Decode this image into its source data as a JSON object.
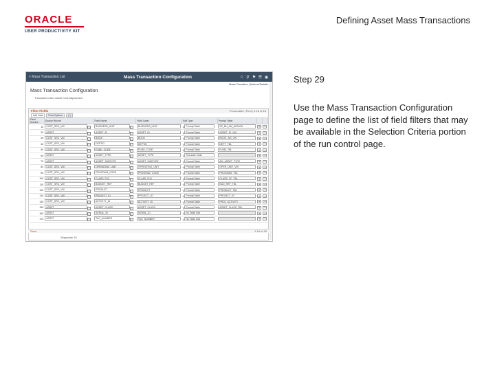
{
  "logo": {
    "brand": "ORACLE",
    "product": "USER PRODUCTIVITY KIT"
  },
  "slide_title": "Defining Asset Mass Transactions",
  "step": {
    "title": "Step 29",
    "description": "Use the Mass Transaction Configuration page to define the list of field filters that may be available in the Selection Criteria portion of the run control page."
  },
  "screenshot": {
    "banner": {
      "back": "< Mass Transaction List",
      "title": "Mass Transaction Configuration"
    },
    "sublinks": "Mass Transfers | Actions/Details",
    "page_title": "Mass Transaction Configuration",
    "transaction": {
      "label": "Transaction",
      "code": "ADJ",
      "desc": "Asset Cost Adjustment"
    },
    "grid": {
      "title": "Filter Fields",
      "nav": "Personalize | Find | 1-18 of 18",
      "tabs": [
        "Add Lists",
        "Field Options",
        "(+)"
      ],
      "columns": [
        "Field Number",
        "Source Record",
        "Field Name",
        "Field Label",
        "Edit Type",
        "Prompt Table",
        "",
        ""
      ],
      "rows": [
        {
          "num": "10",
          "rec": "COST_SRC_VW",
          "field": "BUSINESS_UNIT",
          "label": "BUSINESS_UNIT",
          "edit": "Prompt Table",
          "prompt": "SP_BU_AM_NONVW"
        },
        {
          "num": "20",
          "rec": "ASSET",
          "field": "ASSET_ID",
          "label": "ASSET_ID",
          "edit": "Prompt Table",
          "prompt": "ASSET_ID_VW"
        },
        {
          "num": "30",
          "rec": "COST_SRC_VW",
          "field": "BOOK",
          "label": "BOOK",
          "edit": "Prompt Table",
          "prompt": "BOOK_AM_VW"
        },
        {
          "num": "40",
          "rec": "COST_SRC_VW",
          "field": "DEPTID",
          "label": "DEPTID",
          "edit": "Prompt Table",
          "prompt": "DEPT_TBL"
        },
        {
          "num": "50",
          "rec": "COST_SRC_VW",
          "field": "FUND_CODE",
          "label": "FUND_CODE",
          "edit": "Prompt Table",
          "prompt": "FUND_TBL"
        },
        {
          "num": "60",
          "rec": "ASSET",
          "field": "ASSET_TYPE",
          "label": "ASSET_TYPE",
          "edit": "Translate Table",
          "prompt": ""
        },
        {
          "num": "70",
          "rec": "ASSET",
          "field": "ASSET_SUBTYPE",
          "label": "ASSET_SUBTYPE",
          "edit": "Prompt Table",
          "prompt": "AM_ASSET_TYPE"
        },
        {
          "num": "80",
          "rec": "COST_SRC_VW",
          "field": "OPERATING_UNIT",
          "label": "OPERATING_UNIT",
          "edit": "Prompt Table",
          "prompt": "OPER_UNIT_VW"
        },
        {
          "num": "90",
          "rec": "COST_SRC_VW",
          "field": "PROGRAM_CODE",
          "label": "PROGRAM_CODE",
          "edit": "Prompt Table",
          "prompt": "PROGRAM_TBL"
        },
        {
          "num": "100",
          "rec": "COST_SRC_VW",
          "field": "CLASS_FLD",
          "label": "CLASS_FLD",
          "edit": "Prompt Table",
          "prompt": "CLASS_CF_TBL"
        },
        {
          "num": "110",
          "rec": "COST_SRC_VW",
          "field": "BUDGET_REF",
          "label": "BUDGET_REF",
          "edit": "Prompt Table",
          "prompt": "BUD_REF_TBL"
        },
        {
          "num": "120",
          "rec": "COST_SRC_VW",
          "field": "PRODUCT",
          "label": "PRODUCT",
          "edit": "Prompt Table",
          "prompt": "PRODUCT_TBL"
        },
        {
          "num": "130",
          "rec": "COST_SRC_VW",
          "field": "PROJECT_ID",
          "label": "PROJECT_ID",
          "edit": "Prompt Table",
          "prompt": "PROJECT_ID"
        },
        {
          "num": "140",
          "rec": "COST_SRC_VW",
          "field": "ACTIVITY_ID",
          "label": "ACTIVITY_ID",
          "edit": "Prompt Table",
          "prompt": "PROJ_ACTIVITY"
        },
        {
          "num": "150",
          "rec": "ASSET",
          "field": "ASSET_CLASS",
          "label": "ASSET_CLASS",
          "edit": "Prompt Table",
          "prompt": "ASSET_CLASS_TBL"
        },
        {
          "num": "160",
          "rec": "ASSET",
          "field": "SERIAL_ID",
          "label": "SERIAL_ID",
          "edit": "No Table Edit",
          "prompt": ""
        },
        {
          "num": "170",
          "rec": "ASSET",
          "field": "TAG_NUMBER",
          "label": "TAG_NUMBER",
          "edit": "No Table Edit",
          "prompt": ""
        }
      ]
    },
    "save_label": "Save",
    "page_indicator": "1-18 of 18",
    "sequence": {
      "label": "Sequence",
      "value": "10"
    }
  }
}
